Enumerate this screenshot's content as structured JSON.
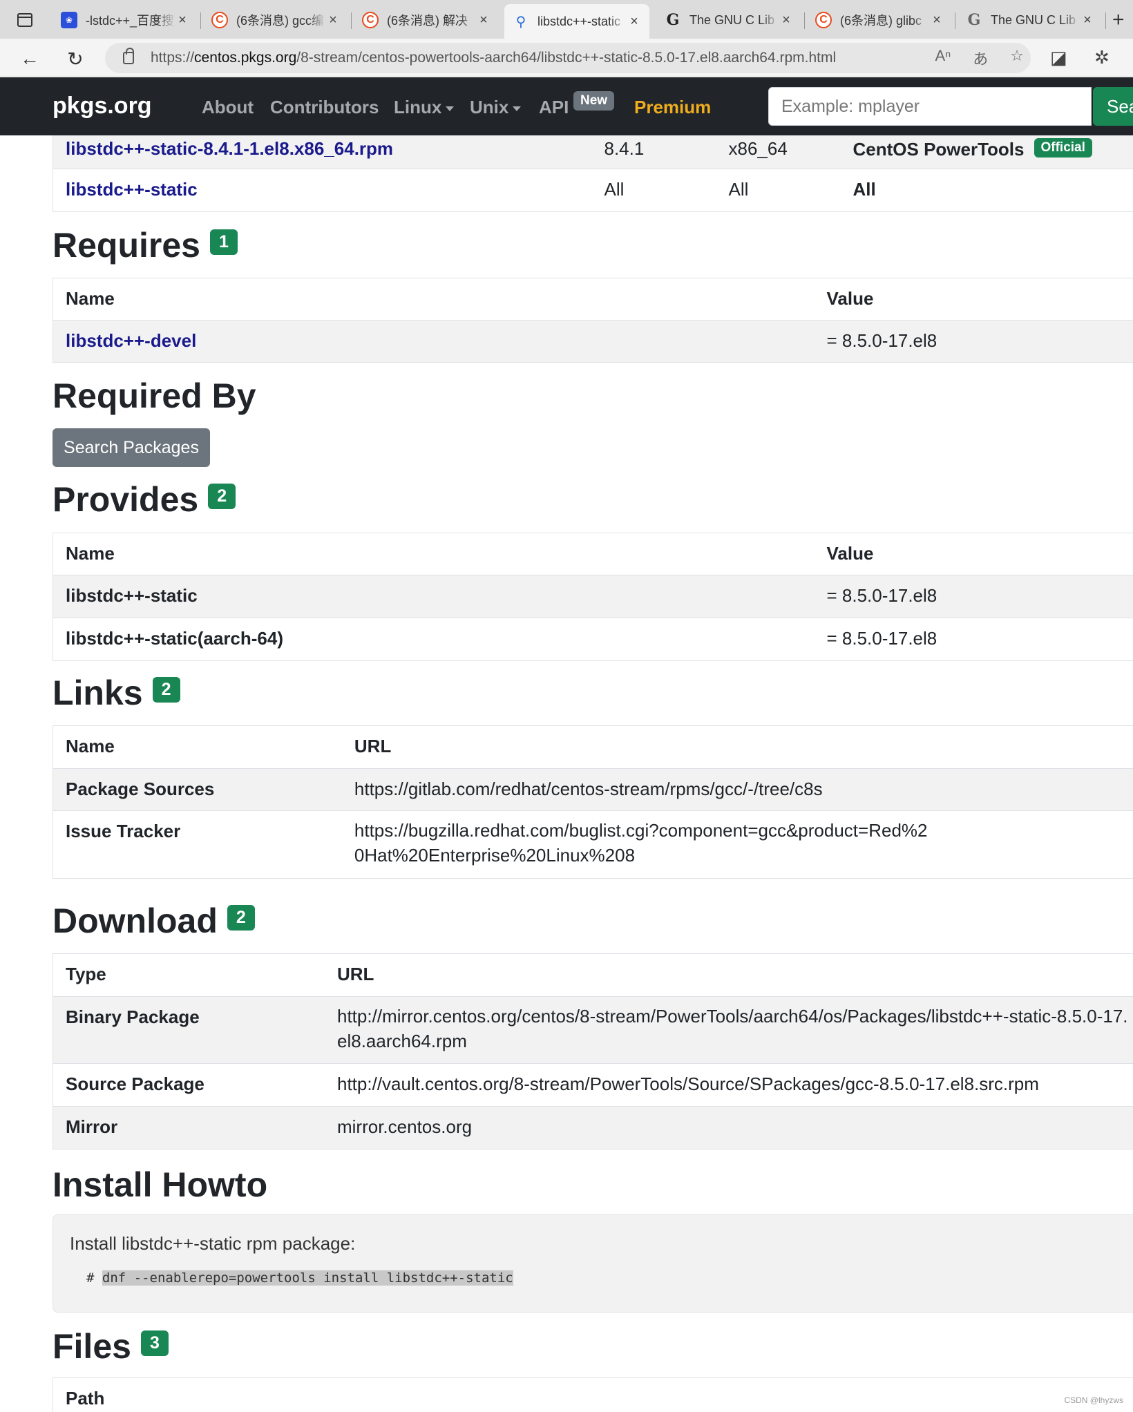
{
  "browser": {
    "tabs": [
      {
        "title": "-lstdc++_百度搜",
        "favicon": "baidu-icon"
      },
      {
        "title": "(6条消息) gcc编",
        "favicon": "csdn-icon"
      },
      {
        "title": "(6条消息) 解决",
        "favicon": "csdn-icon"
      },
      {
        "title": "libstdc++-static",
        "favicon": "search-icon",
        "active": true
      },
      {
        "title": "The GNU C Lib",
        "favicon": "g-icon"
      },
      {
        "title": "(6条消息) glibc",
        "favicon": "csdn-icon"
      },
      {
        "title": "The GNU C Lib",
        "favicon": "g-icon"
      }
    ],
    "url_prefix": "https://",
    "url_host": "centos.pkgs.org",
    "url_path": "/8-stream/centos-powertools-aarch64/libstdc++-static-8.5.0-17.el8.aarch64.rpm.html"
  },
  "navbar": {
    "brand": "pkgs.org",
    "links": [
      "About",
      "Contributors",
      "Linux",
      "Unix",
      "API"
    ],
    "new_badge": "New",
    "premium": "Premium",
    "search_placeholder": "Example: mplayer",
    "search_button": "Search"
  },
  "top_table": {
    "rows": [
      {
        "name": "libstdc++-static-8.4.1-1.el8.x86_64.rpm",
        "version": "8.4.1",
        "arch": "x86_64",
        "repo": "CentOS PowerTools",
        "badge": "Official"
      },
      {
        "name": "libstdc++-static",
        "version": "All",
        "arch": "All",
        "repo": "All"
      }
    ]
  },
  "requires": {
    "title": "Requires",
    "count": "1",
    "headers": [
      "Name",
      "Value"
    ],
    "rows": [
      {
        "name": "libstdc++-devel",
        "value": "= 8.5.0-17.el8"
      }
    ]
  },
  "required_by": {
    "title": "Required By",
    "button": "Search Packages"
  },
  "provides": {
    "title": "Provides",
    "count": "2",
    "headers": [
      "Name",
      "Value"
    ],
    "rows": [
      {
        "name": "libstdc++-static",
        "value": "= 8.5.0-17.el8"
      },
      {
        "name": "libstdc++-static(aarch-64)",
        "value": "= 8.5.0-17.el8"
      }
    ]
  },
  "links": {
    "title": "Links",
    "count": "2",
    "headers": [
      "Name",
      "URL"
    ],
    "rows": [
      {
        "name": "Package Sources",
        "url": "https://gitlab.com/redhat/centos-stream/rpms/gcc/-/tree/c8s"
      },
      {
        "name": "Issue Tracker",
        "url": "https://bugzilla.redhat.com/buglist.cgi?component=gcc&product=Red%20Hat%20Enterprise%20Linux%208"
      }
    ]
  },
  "download": {
    "title": "Download",
    "count": "2",
    "headers": [
      "Type",
      "URL"
    ],
    "rows": [
      {
        "type": "Binary Package",
        "url": "http://mirror.centos.org/centos/8-stream/PowerTools/aarch64/os/Packages/libstdc++-static-8.5.0-17.el8.aarch64.rpm"
      },
      {
        "type": "Source Package",
        "url": "http://vault.centos.org/8-stream/PowerTools/Source/SPackages/gcc-8.5.0-17.el8.src.rpm"
      },
      {
        "type": "Mirror",
        "url": "mirror.centos.org"
      }
    ]
  },
  "install_howto": {
    "title": "Install Howto",
    "text": "Install libstdc++-static rpm package:",
    "prompt": "#",
    "command": "dnf --enablerepo=powertools install libstdc++-static"
  },
  "files": {
    "title": "Files",
    "count": "3",
    "headers": [
      "Path"
    ]
  },
  "watermark": "CSDN @lhyzws"
}
